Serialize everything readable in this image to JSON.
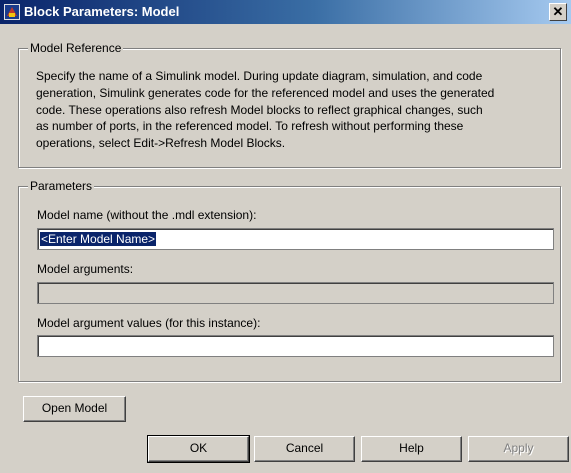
{
  "window": {
    "title": "Block Parameters: Model",
    "close_glyph": "✕"
  },
  "model_reference": {
    "legend": "Model Reference",
    "description_lines": [
      "Specify the name of a Simulink model. During update diagram, simulation, and code",
      "generation, Simulink generates code for the referenced model and uses the generated",
      "code.  These operations also refresh Model blocks to reflect graphical changes, such",
      "as number of ports, in the referenced model. To refresh without performing these",
      "operations, select Edit->Refresh Model Blocks."
    ]
  },
  "parameters": {
    "legend": "Parameters",
    "model_name_label": "Model name (without the .mdl extension):",
    "model_name_value": "<Enter Model Name>",
    "model_arguments_label": "Model arguments:",
    "model_arguments_value": "",
    "model_argument_values_label": "Model argument values (for this instance):",
    "model_argument_values_value": ""
  },
  "buttons": {
    "open_model": "Open Model",
    "ok": "OK",
    "cancel": "Cancel",
    "help": "Help",
    "apply": "Apply"
  }
}
